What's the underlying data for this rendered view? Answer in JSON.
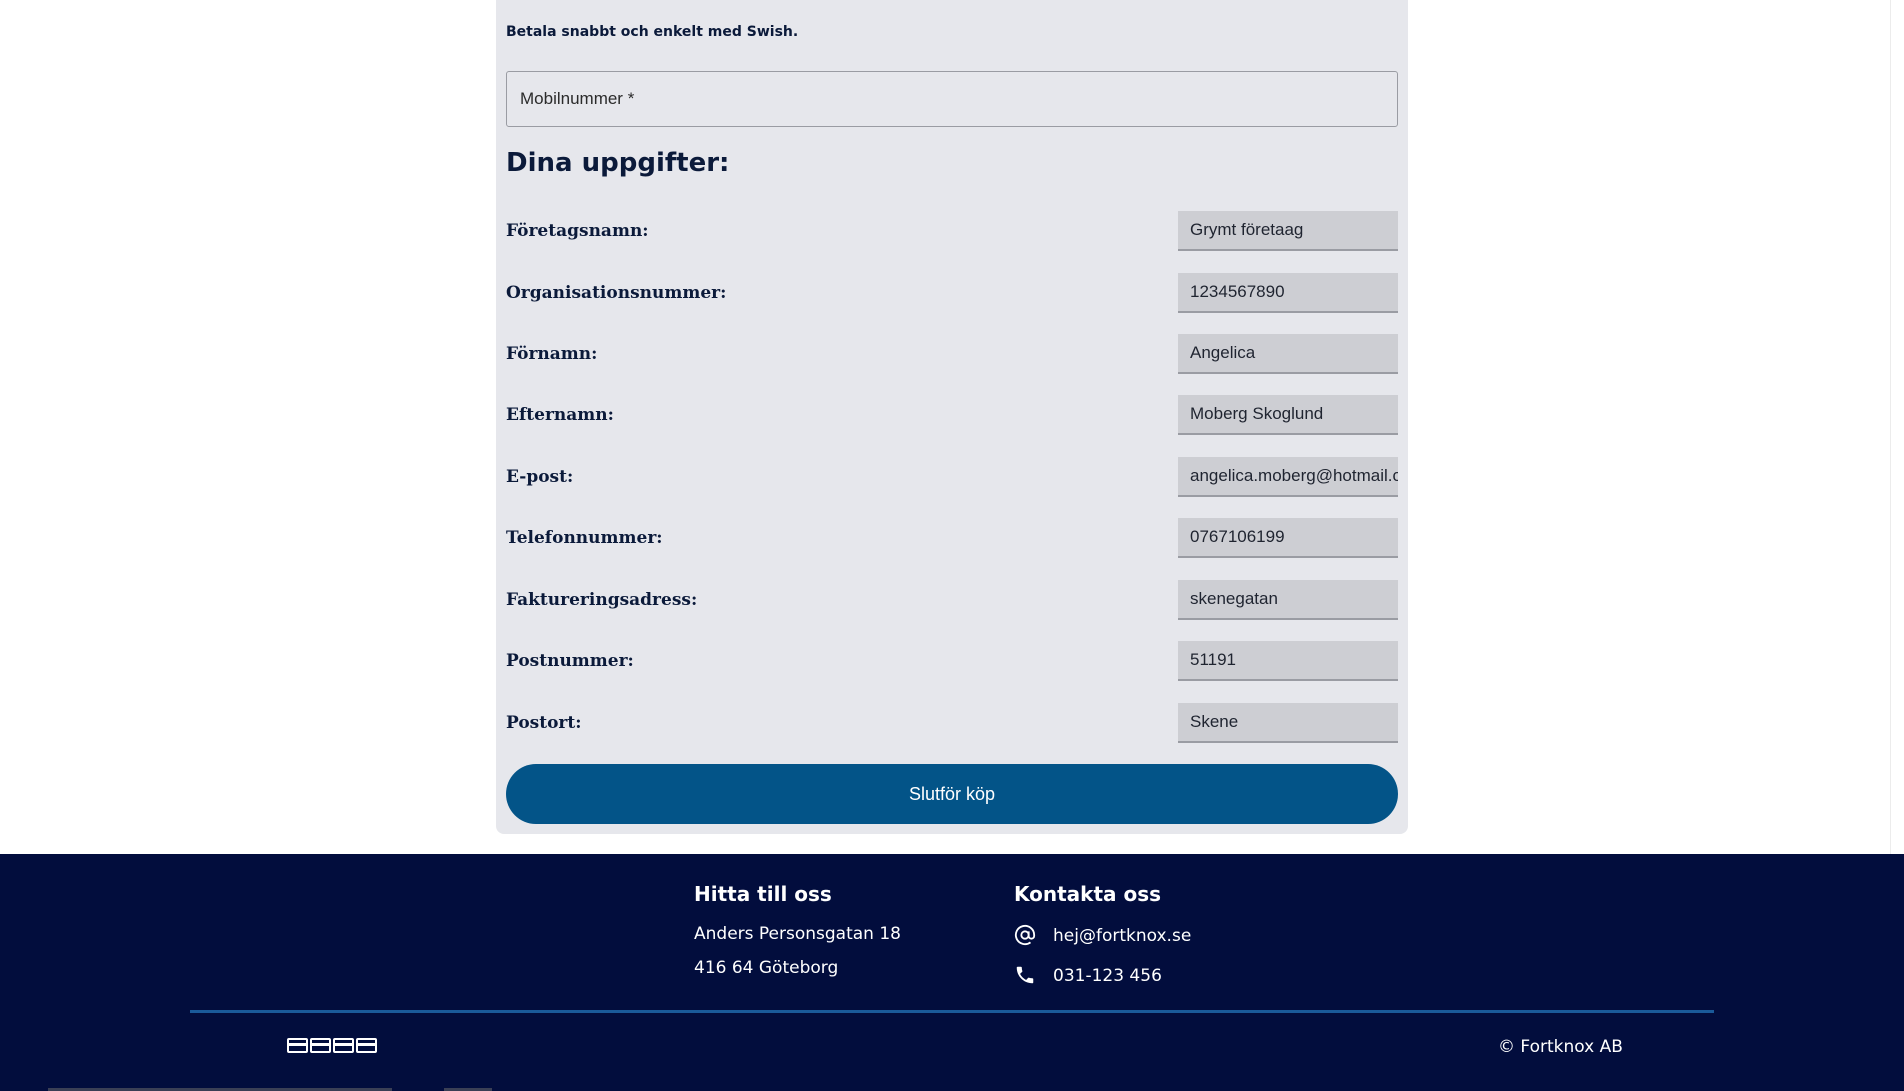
{
  "payment": {
    "swish_text": "Betala snabbt och enkelt med Swish.",
    "mobile_placeholder": "Mobilnummer *"
  },
  "details": {
    "title": "Dina uppgifter:",
    "fields": [
      {
        "label": "Företagsnamn:",
        "value": "Grymt företaag"
      },
      {
        "label": "Organisationsnummer:",
        "value": "1234567890"
      },
      {
        "label": "Förnamn:",
        "value": "Angelica"
      },
      {
        "label": "Efternamn:",
        "value": "Moberg Skoglund"
      },
      {
        "label": "E-post:",
        "value": "angelica.moberg@hotmail.com"
      },
      {
        "label": "Telefonnummer:",
        "value": "0767106199"
      },
      {
        "label": "Faktureringsadress:",
        "value": "skenegatan"
      },
      {
        "label": "Postnummer:",
        "value": "51191"
      },
      {
        "label": "Postort:",
        "value": "Skene"
      }
    ],
    "submit_label": "Slutför köp"
  },
  "footer": {
    "find_us": {
      "heading": "Hitta till oss",
      "address_line1": "Anders Personsgatan 18",
      "address_line2": "416 64 Göteborg"
    },
    "contact": {
      "heading": "Kontakta oss",
      "email": "hej@fortknox.se",
      "phone": "031-123 456"
    },
    "copyright": "© Fortknox AB",
    "payment_icons": [
      "card-icon",
      "card-icon",
      "card-icon",
      "card-icon"
    ]
  },
  "colors": {
    "panel_bg": "#e6e7ec",
    "button_bg": "#035488",
    "footer_bg": "#020d3d",
    "text_dark": "#0b1a3a"
  }
}
